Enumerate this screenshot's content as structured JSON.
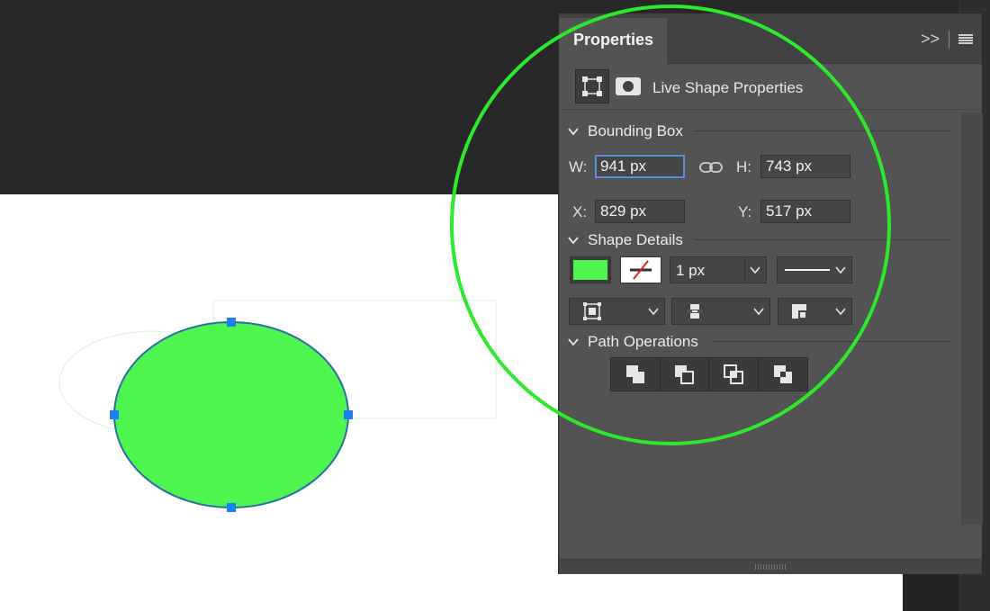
{
  "panel": {
    "tab_label": "Properties",
    "expand_glyph": ">>",
    "subheader_label": "Live Shape Properties"
  },
  "bounding_box": {
    "label": "Bounding Box",
    "w_label": "W:",
    "w_value": "941 px",
    "h_label": "H:",
    "h_value": "743 px",
    "x_label": "X:",
    "x_value": "829 px",
    "y_label": "Y:",
    "y_value": "517 px"
  },
  "shape_details": {
    "label": "Shape Details",
    "fill_color": "#4ff54f",
    "stroke_width": "1 px"
  },
  "path_operations": {
    "label": "Path Operations"
  },
  "colors": {
    "highlight": "#2ee82e",
    "selection_handle": "#1e7ff0",
    "shape_stroke": "#2a6ca8"
  }
}
